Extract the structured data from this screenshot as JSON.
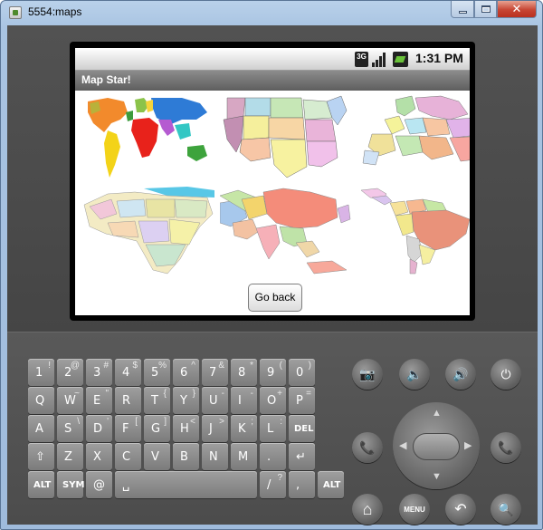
{
  "window": {
    "title": "5554:maps",
    "min_glyph": "",
    "max_glyph": "",
    "close_glyph": "✕"
  },
  "statusbar": {
    "network": "3G",
    "time": "1:31 PM"
  },
  "app": {
    "title": "Map Star!",
    "go_back_label": "Go back"
  },
  "maps": [
    {
      "name": "world-map"
    },
    {
      "name": "usa-map"
    },
    {
      "name": "europe-map"
    },
    {
      "name": "africa-map"
    },
    {
      "name": "asia-map"
    },
    {
      "name": "south-america-map"
    }
  ],
  "keyboard": {
    "rows": [
      [
        {
          "m": "1",
          "a": "!"
        },
        {
          "m": "2",
          "a": "@"
        },
        {
          "m": "3",
          "a": "#"
        },
        {
          "m": "4",
          "a": "$"
        },
        {
          "m": "5",
          "a": "%"
        },
        {
          "m": "6",
          "a": "^"
        },
        {
          "m": "7",
          "a": "&"
        },
        {
          "m": "8",
          "a": "*"
        },
        {
          "m": "9",
          "a": "("
        },
        {
          "m": "0",
          "a": ")"
        }
      ],
      [
        {
          "m": "Q",
          "a": ""
        },
        {
          "m": "W",
          "a": "~"
        },
        {
          "m": "E",
          "a": "\""
        },
        {
          "m": "R",
          "a": ""
        },
        {
          "m": "T",
          "a": "{"
        },
        {
          "m": "Y",
          "a": "}"
        },
        {
          "m": "U",
          "a": "-"
        },
        {
          "m": "I",
          "a": "-"
        },
        {
          "m": "O",
          "a": "+"
        },
        {
          "m": "P",
          "a": "="
        }
      ],
      [
        {
          "m": "A",
          "a": ""
        },
        {
          "m": "S",
          "a": "\\"
        },
        {
          "m": "D",
          "a": "'"
        },
        {
          "m": "F",
          "a": "["
        },
        {
          "m": "G",
          "a": "]"
        },
        {
          "m": "H",
          "a": "<"
        },
        {
          "m": "J",
          "a": ">"
        },
        {
          "m": "K",
          "a": ";"
        },
        {
          "m": "L",
          "a": ":"
        },
        {
          "m": "DEL",
          "a": ""
        }
      ],
      [
        {
          "m": "⇧",
          "a": ""
        },
        {
          "m": "Z",
          "a": ""
        },
        {
          "m": "X",
          "a": ""
        },
        {
          "m": "C",
          "a": ""
        },
        {
          "m": "V",
          "a": ""
        },
        {
          "m": "B",
          "a": ""
        },
        {
          "m": "N",
          "a": ""
        },
        {
          "m": "M",
          "a": ""
        },
        {
          "m": ".",
          "a": ""
        },
        {
          "m": "↵",
          "a": ""
        }
      ],
      [
        {
          "m": "ALT",
          "a": ""
        },
        {
          "m": "SYM",
          "a": ""
        },
        {
          "m": "@",
          "a": ""
        },
        {
          "m": "␣",
          "a": ""
        },
        {
          "m": "/",
          "a": "?"
        },
        {
          "m": ",",
          "a": ""
        },
        {
          "m": "ALT",
          "a": ""
        }
      ]
    ]
  },
  "controls": {
    "camera": "📷",
    "vol_down": "🔈",
    "vol_up": "🔊",
    "power": "⏻",
    "call": "📞",
    "end_call": "📞",
    "home": "⌂",
    "menu": "MENU",
    "back": "↶",
    "search": "🔍"
  }
}
